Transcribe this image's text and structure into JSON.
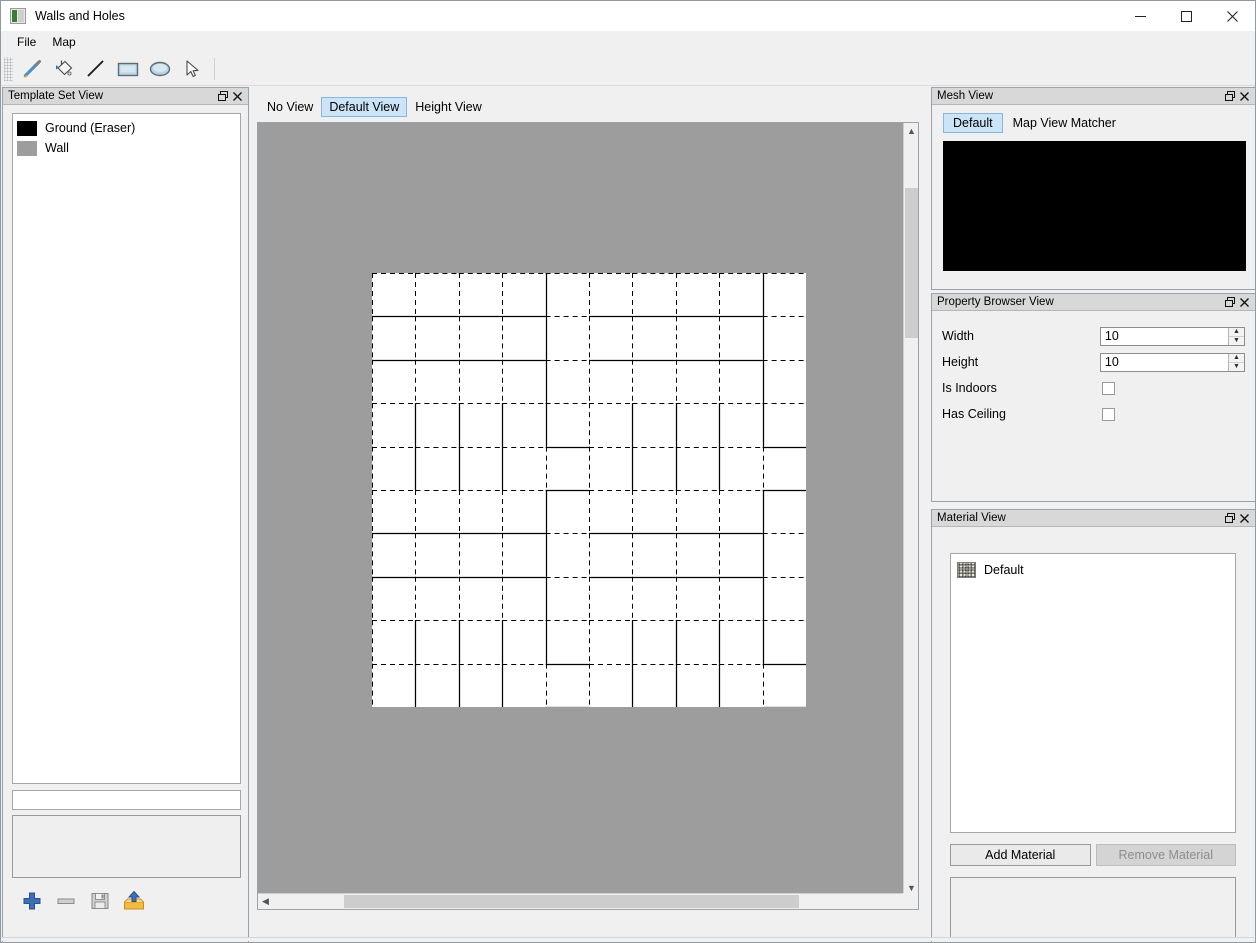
{
  "window": {
    "title": "Walls and Holes",
    "icon": "app-icon",
    "controls": [
      {
        "name": "minimize",
        "glyph": "minimize-icon"
      },
      {
        "name": "maximize",
        "glyph": "maximize-icon"
      },
      {
        "name": "close",
        "glyph": "close-icon"
      }
    ]
  },
  "menubar": {
    "items": [
      {
        "label": "File"
      },
      {
        "label": "Map"
      }
    ]
  },
  "toolbar": {
    "tools": [
      {
        "name": "brush-tool",
        "icon": "paintbrush-icon",
        "active": false
      },
      {
        "name": "fill-tool",
        "icon": "paint-bucket-icon",
        "active": false
      },
      {
        "name": "line-tool",
        "icon": "line-icon",
        "active": false
      },
      {
        "name": "rectangle-tool",
        "icon": "rectangle-icon",
        "active": false
      },
      {
        "name": "ellipse-tool",
        "icon": "ellipse-icon",
        "active": false
      },
      {
        "name": "select-tool",
        "icon": "cursor-arrow-icon",
        "active": false
      }
    ]
  },
  "template_set_view": {
    "title": "Template Set View",
    "float_button": "float-icon",
    "close_button": "close-icon",
    "items": [
      {
        "label": "Ground (Eraser)",
        "color": "#000000"
      },
      {
        "label": "Wall",
        "color": "#9d9d9d"
      }
    ],
    "name_input_value": "",
    "name_input_placeholder": "",
    "actions": [
      {
        "name": "add-template",
        "icon": "plus-icon"
      },
      {
        "name": "remove-template",
        "icon": "minus-icon"
      },
      {
        "name": "save-template-set",
        "icon": "save-icon"
      },
      {
        "name": "load-template-set",
        "icon": "load-icon"
      }
    ]
  },
  "center": {
    "tabs": [
      {
        "label": "No View",
        "active": false
      },
      {
        "label": "Default View",
        "active": true
      },
      {
        "label": "Height View",
        "active": false
      }
    ],
    "canvas": {
      "background_color": "#9d9d9d",
      "cell_color": "#ffffff",
      "grid_cols": 10,
      "grid_rows": 10,
      "cell_size": 43.4,
      "horizontal_scrollbar": {
        "left_arrow": "chevron-left-icon",
        "right_arrow": "chevron-right-icon"
      },
      "vertical_scrollbar": {
        "up_arrow": "chevron-up-icon",
        "down_arrow": "chevron-down-icon"
      }
    }
  },
  "grid_walls": {
    "note": "h[r][c] = horizontal edge above row r at column c; v[r][c] = vertical edge left of column c in row r. true = solid wall, false = dashed empty.",
    "h": [
      [
        false,
        false,
        false,
        false,
        false,
        false,
        false,
        false,
        false,
        false
      ],
      [
        true,
        true,
        true,
        true,
        false,
        true,
        true,
        true,
        true,
        false
      ],
      [
        true,
        true,
        true,
        true,
        false,
        true,
        true,
        true,
        true,
        false
      ],
      [
        false,
        false,
        false,
        false,
        false,
        false,
        false,
        false,
        false,
        false
      ],
      [
        false,
        false,
        false,
        false,
        true,
        false,
        false,
        false,
        false,
        true
      ],
      [
        false,
        false,
        false,
        false,
        true,
        false,
        false,
        false,
        false,
        true
      ],
      [
        true,
        true,
        true,
        true,
        false,
        true,
        true,
        true,
        true,
        false
      ],
      [
        true,
        true,
        true,
        true,
        false,
        true,
        true,
        true,
        true,
        false
      ],
      [
        false,
        false,
        false,
        false,
        false,
        false,
        false,
        false,
        false,
        false
      ],
      [
        false,
        false,
        false,
        false,
        true,
        false,
        false,
        false,
        false,
        true
      ],
      [
        false,
        false,
        false,
        false,
        true,
        false,
        false,
        false,
        false,
        true
      ]
    ],
    "v": [
      [
        false,
        false,
        false,
        false,
        true,
        false,
        false,
        false,
        false,
        true,
        false
      ],
      [
        false,
        false,
        false,
        false,
        true,
        false,
        false,
        false,
        false,
        true,
        false
      ],
      [
        false,
        false,
        false,
        false,
        true,
        false,
        false,
        false,
        false,
        true,
        false
      ],
      [
        false,
        true,
        true,
        true,
        true,
        false,
        true,
        true,
        true,
        true,
        false
      ],
      [
        false,
        true,
        true,
        true,
        false,
        false,
        true,
        true,
        true,
        false,
        false
      ],
      [
        false,
        false,
        false,
        false,
        true,
        false,
        false,
        false,
        false,
        true,
        false
      ],
      [
        false,
        false,
        false,
        false,
        true,
        false,
        false,
        false,
        false,
        true,
        false
      ],
      [
        false,
        false,
        false,
        false,
        true,
        false,
        false,
        false,
        false,
        true,
        false
      ],
      [
        false,
        true,
        true,
        true,
        true,
        false,
        true,
        true,
        true,
        true,
        false
      ],
      [
        false,
        true,
        true,
        true,
        false,
        false,
        true,
        true,
        true,
        false,
        false
      ]
    ]
  },
  "mesh_view": {
    "title": "Mesh View",
    "float_button": "float-icon",
    "close_button": "close-icon",
    "tabs": [
      {
        "label": "Default",
        "active": true
      },
      {
        "label": "Map View Matcher",
        "active": false
      }
    ],
    "preview_color": "#000000"
  },
  "property_browser_view": {
    "title": "Property Browser View",
    "float_button": "float-icon",
    "close_button": "close-icon",
    "rows": [
      {
        "label": "Width",
        "type": "spin",
        "value": "10"
      },
      {
        "label": "Height",
        "type": "spin",
        "value": "10"
      },
      {
        "label": "Is Indoors",
        "type": "checkbox",
        "checked": false
      },
      {
        "label": "Has Ceiling",
        "type": "checkbox",
        "checked": false
      }
    ]
  },
  "material_view": {
    "title": "Material View",
    "float_button": "float-icon",
    "close_button": "close-icon",
    "items": [
      {
        "label": "Default",
        "swatch": "noise-texture-swatch"
      }
    ],
    "add_button": "Add Material",
    "remove_button": "Remove Material",
    "remove_disabled": true
  },
  "colors": {
    "accent": "#cce4f7",
    "accent_border": "#8ab6dd",
    "panel_bg": "#f0f0f0",
    "dock_title_bg": "#d8d8d8",
    "canvas_bg": "#9d9d9d"
  }
}
